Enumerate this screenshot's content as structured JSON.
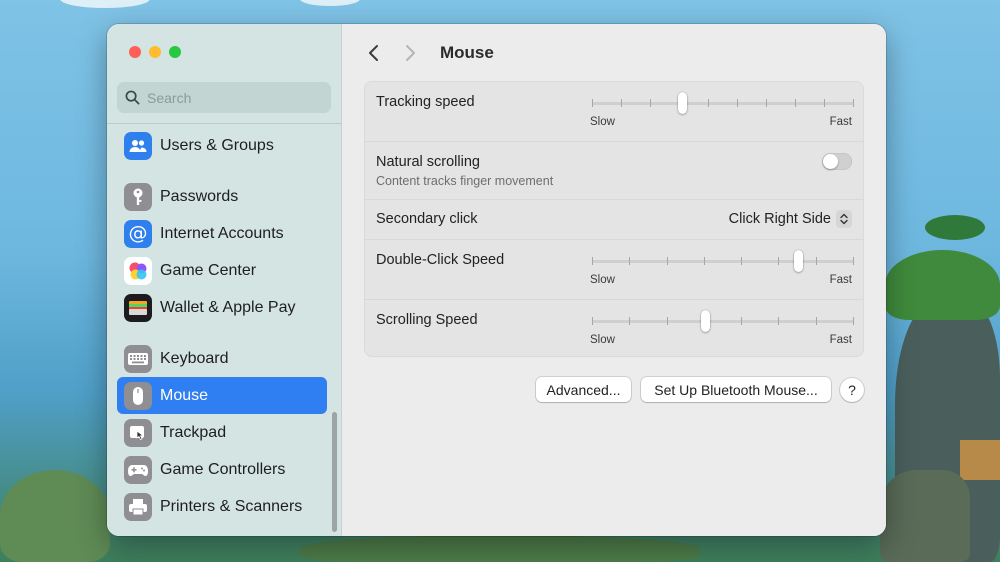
{
  "window": {
    "title": "Mouse"
  },
  "sidebar": {
    "search_placeholder": "Search",
    "items": [
      {
        "label": "Users & Groups",
        "icon": "users-icon",
        "color": "#2f80ed"
      },
      {
        "label": "Passwords",
        "icon": "key-icon",
        "color": "#8e8e93"
      },
      {
        "label": "Internet Accounts",
        "icon": "at-sign-icon",
        "color": "#2f80ed"
      },
      {
        "label": "Game Center",
        "icon": "game-center-icon",
        "color": "#ffffff"
      },
      {
        "label": "Wallet & Apple Pay",
        "icon": "wallet-icon",
        "color": "#1c1c1e"
      },
      {
        "label": "Keyboard",
        "icon": "keyboard-icon",
        "color": "#8e8e93"
      },
      {
        "label": "Mouse",
        "icon": "mouse-icon",
        "color": "#8e8e93",
        "selected": true
      },
      {
        "label": "Trackpad",
        "icon": "trackpad-icon",
        "color": "#8e8e93"
      },
      {
        "label": "Game Controllers",
        "icon": "gamepad-icon",
        "color": "#8e8e93"
      },
      {
        "label": "Printers & Scanners",
        "icon": "printer-icon",
        "color": "#8e8e93"
      }
    ]
  },
  "settings": {
    "tracking_speed": {
      "label": "Tracking speed",
      "min_label": "Slow",
      "max_label": "Fast",
      "value": 0.34,
      "ticks": 10
    },
    "natural_scrolling": {
      "label": "Natural scrolling",
      "description": "Content tracks finger movement",
      "enabled": false
    },
    "secondary_click": {
      "label": "Secondary click",
      "value": "Click Right Side"
    },
    "double_click_speed": {
      "label": "Double-Click Speed",
      "min_label": "Slow",
      "max_label": "Fast",
      "value": 0.8,
      "ticks": 8
    },
    "scrolling_speed": {
      "label": "Scrolling Speed",
      "min_label": "Slow",
      "max_label": "Fast",
      "value": 0.43,
      "ticks": 8
    }
  },
  "buttons": {
    "advanced": "Advanced...",
    "bluetooth": "Set Up Bluetooth Mouse...",
    "help": "?"
  },
  "colors": {
    "accent": "#2f7ff2"
  }
}
